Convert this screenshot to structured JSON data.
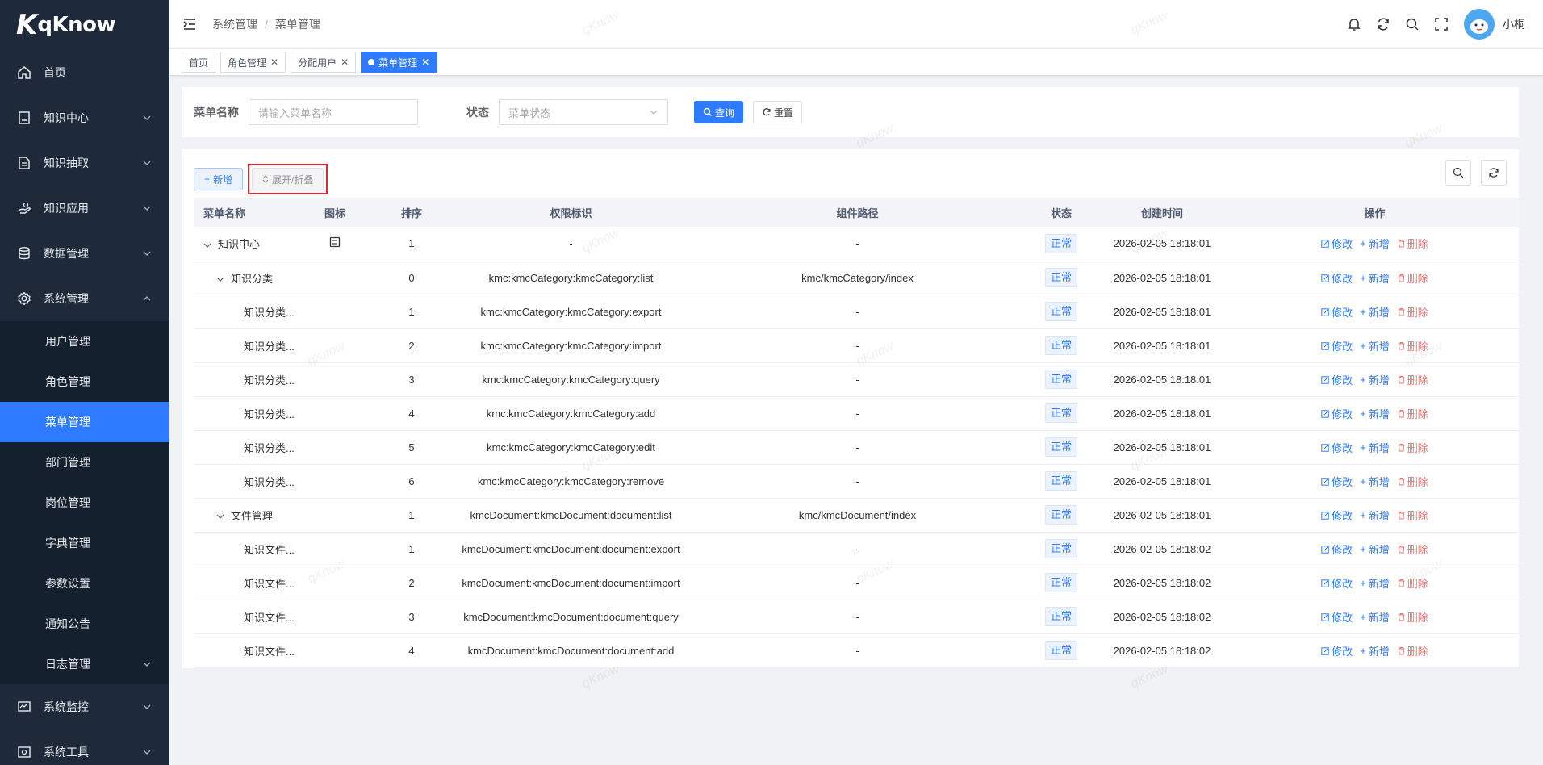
{
  "brand": {
    "mark": "K",
    "name": "qKnow"
  },
  "sidebar": {
    "items": [
      {
        "label": "首页",
        "icon": "home-icon"
      },
      {
        "label": "知识中心",
        "icon": "book-icon"
      },
      {
        "label": "知识抽取",
        "icon": "document-icon"
      },
      {
        "label": "知识应用",
        "icon": "hand-icon"
      },
      {
        "label": "数据管理",
        "icon": "database-icon"
      },
      {
        "label": "系统管理",
        "icon": "gear-icon"
      }
    ],
    "system_sub": [
      "用户管理",
      "角色管理",
      "菜单管理",
      "部门管理",
      "岗位管理",
      "字典管理",
      "参数设置",
      "通知公告",
      "日志管理"
    ],
    "bottom_items": [
      {
        "label": "系统监控",
        "icon": "monitor-icon"
      },
      {
        "label": "系统工具",
        "icon": "tool-icon"
      }
    ]
  },
  "header": {
    "breadcrumb": [
      "系统管理",
      "菜单管理"
    ],
    "separator": "/",
    "username": "小桐"
  },
  "tags": [
    {
      "label": "首页"
    },
    {
      "label": "角色管理"
    },
    {
      "label": "分配用户"
    },
    {
      "label": "菜单管理"
    }
  ],
  "search": {
    "name_label": "菜单名称",
    "name_placeholder": "请输入菜单名称",
    "status_label": "状态",
    "status_placeholder": "菜单状态",
    "query_label": "查询",
    "reset_label": "重置"
  },
  "toolbar": {
    "add_label": "新增",
    "expand_label": "展开/折叠"
  },
  "table": {
    "columns": [
      "菜单名称",
      "图标",
      "排序",
      "权限标识",
      "组件路径",
      "状态",
      "创建时间",
      "操作"
    ],
    "op_edit": "修改",
    "op_add": "新增",
    "op_delete": "删除",
    "rows": [
      {
        "name": "知识中心",
        "level": 0,
        "expand": true,
        "icon": "book",
        "order": "1",
        "perm": "-",
        "path": "-",
        "status": "正常",
        "time": "2026-02-05 18:18:01"
      },
      {
        "name": "知识分类",
        "level": 1,
        "expand": true,
        "icon": "",
        "order": "0",
        "perm": "kmc:kmcCategory:kmcCategory:list",
        "path": "kmc/kmcCategory/index",
        "status": "正常",
        "time": "2026-02-05 18:18:01"
      },
      {
        "name": "知识分类...",
        "level": 2,
        "expand": false,
        "icon": "",
        "order": "1",
        "perm": "kmc:kmcCategory:kmcCategory:export",
        "path": "-",
        "status": "正常",
        "time": "2026-02-05 18:18:01"
      },
      {
        "name": "知识分类...",
        "level": 2,
        "expand": false,
        "icon": "",
        "order": "2",
        "perm": "kmc:kmcCategory:kmcCategory:import",
        "path": "-",
        "status": "正常",
        "time": "2026-02-05 18:18:01"
      },
      {
        "name": "知识分类...",
        "level": 2,
        "expand": false,
        "icon": "",
        "order": "3",
        "perm": "kmc:kmcCategory:kmcCategory:query",
        "path": "-",
        "status": "正常",
        "time": "2026-02-05 18:18:01"
      },
      {
        "name": "知识分类...",
        "level": 2,
        "expand": false,
        "icon": "",
        "order": "4",
        "perm": "kmc:kmcCategory:kmcCategory:add",
        "path": "-",
        "status": "正常",
        "time": "2026-02-05 18:18:01"
      },
      {
        "name": "知识分类...",
        "level": 2,
        "expand": false,
        "icon": "",
        "order": "5",
        "perm": "kmc:kmcCategory:kmcCategory:edit",
        "path": "-",
        "status": "正常",
        "time": "2026-02-05 18:18:01"
      },
      {
        "name": "知识分类...",
        "level": 2,
        "expand": false,
        "icon": "",
        "order": "6",
        "perm": "kmc:kmcCategory:kmcCategory:remove",
        "path": "-",
        "status": "正常",
        "time": "2026-02-05 18:18:01"
      },
      {
        "name": "文件管理",
        "level": 1,
        "expand": true,
        "icon": "",
        "order": "1",
        "perm": "kmcDocument:kmcDocument:document:list",
        "path": "kmc/kmcDocument/index",
        "status": "正常",
        "time": "2026-02-05 18:18:01"
      },
      {
        "name": "知识文件...",
        "level": 2,
        "expand": false,
        "icon": "",
        "order": "1",
        "perm": "kmcDocument:kmcDocument:document:export",
        "path": "-",
        "status": "正常",
        "time": "2026-02-05 18:18:02"
      },
      {
        "name": "知识文件...",
        "level": 2,
        "expand": false,
        "icon": "",
        "order": "2",
        "perm": "kmcDocument:kmcDocument:document:import",
        "path": "-",
        "status": "正常",
        "time": "2026-02-05 18:18:02"
      },
      {
        "name": "知识文件...",
        "level": 2,
        "expand": false,
        "icon": "",
        "order": "3",
        "perm": "kmcDocument:kmcDocument:document:query",
        "path": "-",
        "status": "正常",
        "time": "2026-02-05 18:18:02"
      },
      {
        "name": "知识文件...",
        "level": 2,
        "expand": false,
        "icon": "",
        "order": "4",
        "perm": "kmcDocument:kmcDocument:document:add",
        "path": "-",
        "status": "正常",
        "time": "2026-02-05 18:18:02"
      }
    ]
  },
  "watermark": "qKnow",
  "colors": {
    "primary": "#2f7bff",
    "danger": "#f56c6c",
    "sidebar_bg": "#1e2a3a"
  }
}
